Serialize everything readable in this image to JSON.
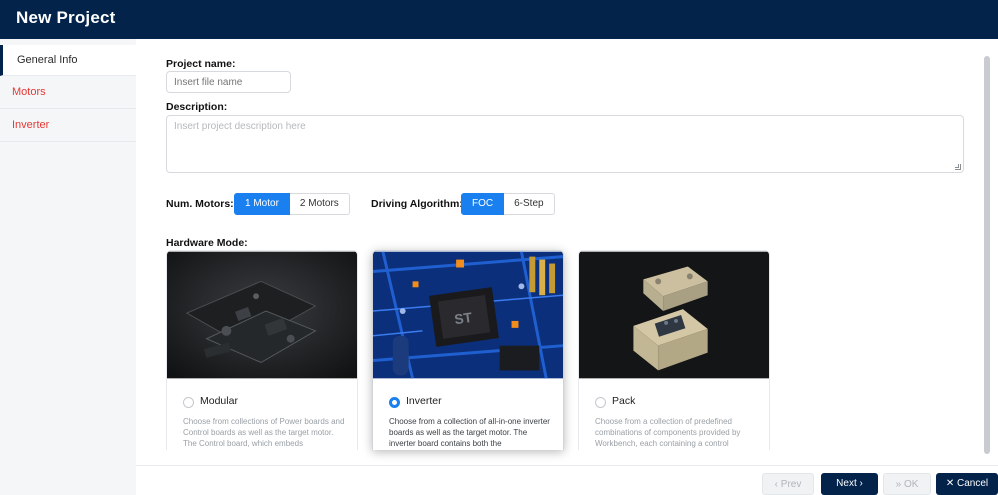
{
  "window": {
    "title": "New Project"
  },
  "sidebar": {
    "items": [
      {
        "label": "General Info"
      },
      {
        "label": "Motors"
      },
      {
        "label": "Inverter"
      }
    ]
  },
  "form": {
    "project_name": {
      "label": "Project name:",
      "placeholder": "Insert file name",
      "value": ""
    },
    "description": {
      "label": "Description:",
      "placeholder": "Insert project description here",
      "value": ""
    },
    "num_motors": {
      "label": "Num. Motors:",
      "options": [
        "1 Motor",
        "2 Motors"
      ],
      "selected": "1 Motor"
    },
    "driving_algorithm": {
      "label": "Driving Algorithm:",
      "options": [
        "FOC",
        "6-Step"
      ],
      "selected": "FOC"
    },
    "hardware_mode": {
      "label": "Hardware Mode:",
      "selected": "Inverter",
      "cards": [
        {
          "title": "Modular",
          "description": "Choose from collections of Power boards and Control boards as well as the target motor. The Control board, which embeds",
          "selected": false
        },
        {
          "title": "Inverter",
          "description": "Choose from a collection of all-in-one inverter boards as well as the target motor. The inverter board contains both the",
          "selected": true
        },
        {
          "title": "Pack",
          "description": "Choose from a collection of predefined combinations of components provided by Workbench, each containing a control",
          "selected": false
        }
      ]
    }
  },
  "footer": {
    "prev_label": "Prev",
    "next_label": "Next",
    "ok_label": "OK",
    "cancel_label": "Cancel"
  },
  "colors": {
    "header_bg": "#03234b",
    "accent": "#1a80f0",
    "error": "#e53935"
  },
  "icons": {
    "prev": "chevron-left-icon",
    "next": "chevron-right-icon",
    "ok": "double-chevron-right-icon",
    "cancel": "close-icon"
  }
}
